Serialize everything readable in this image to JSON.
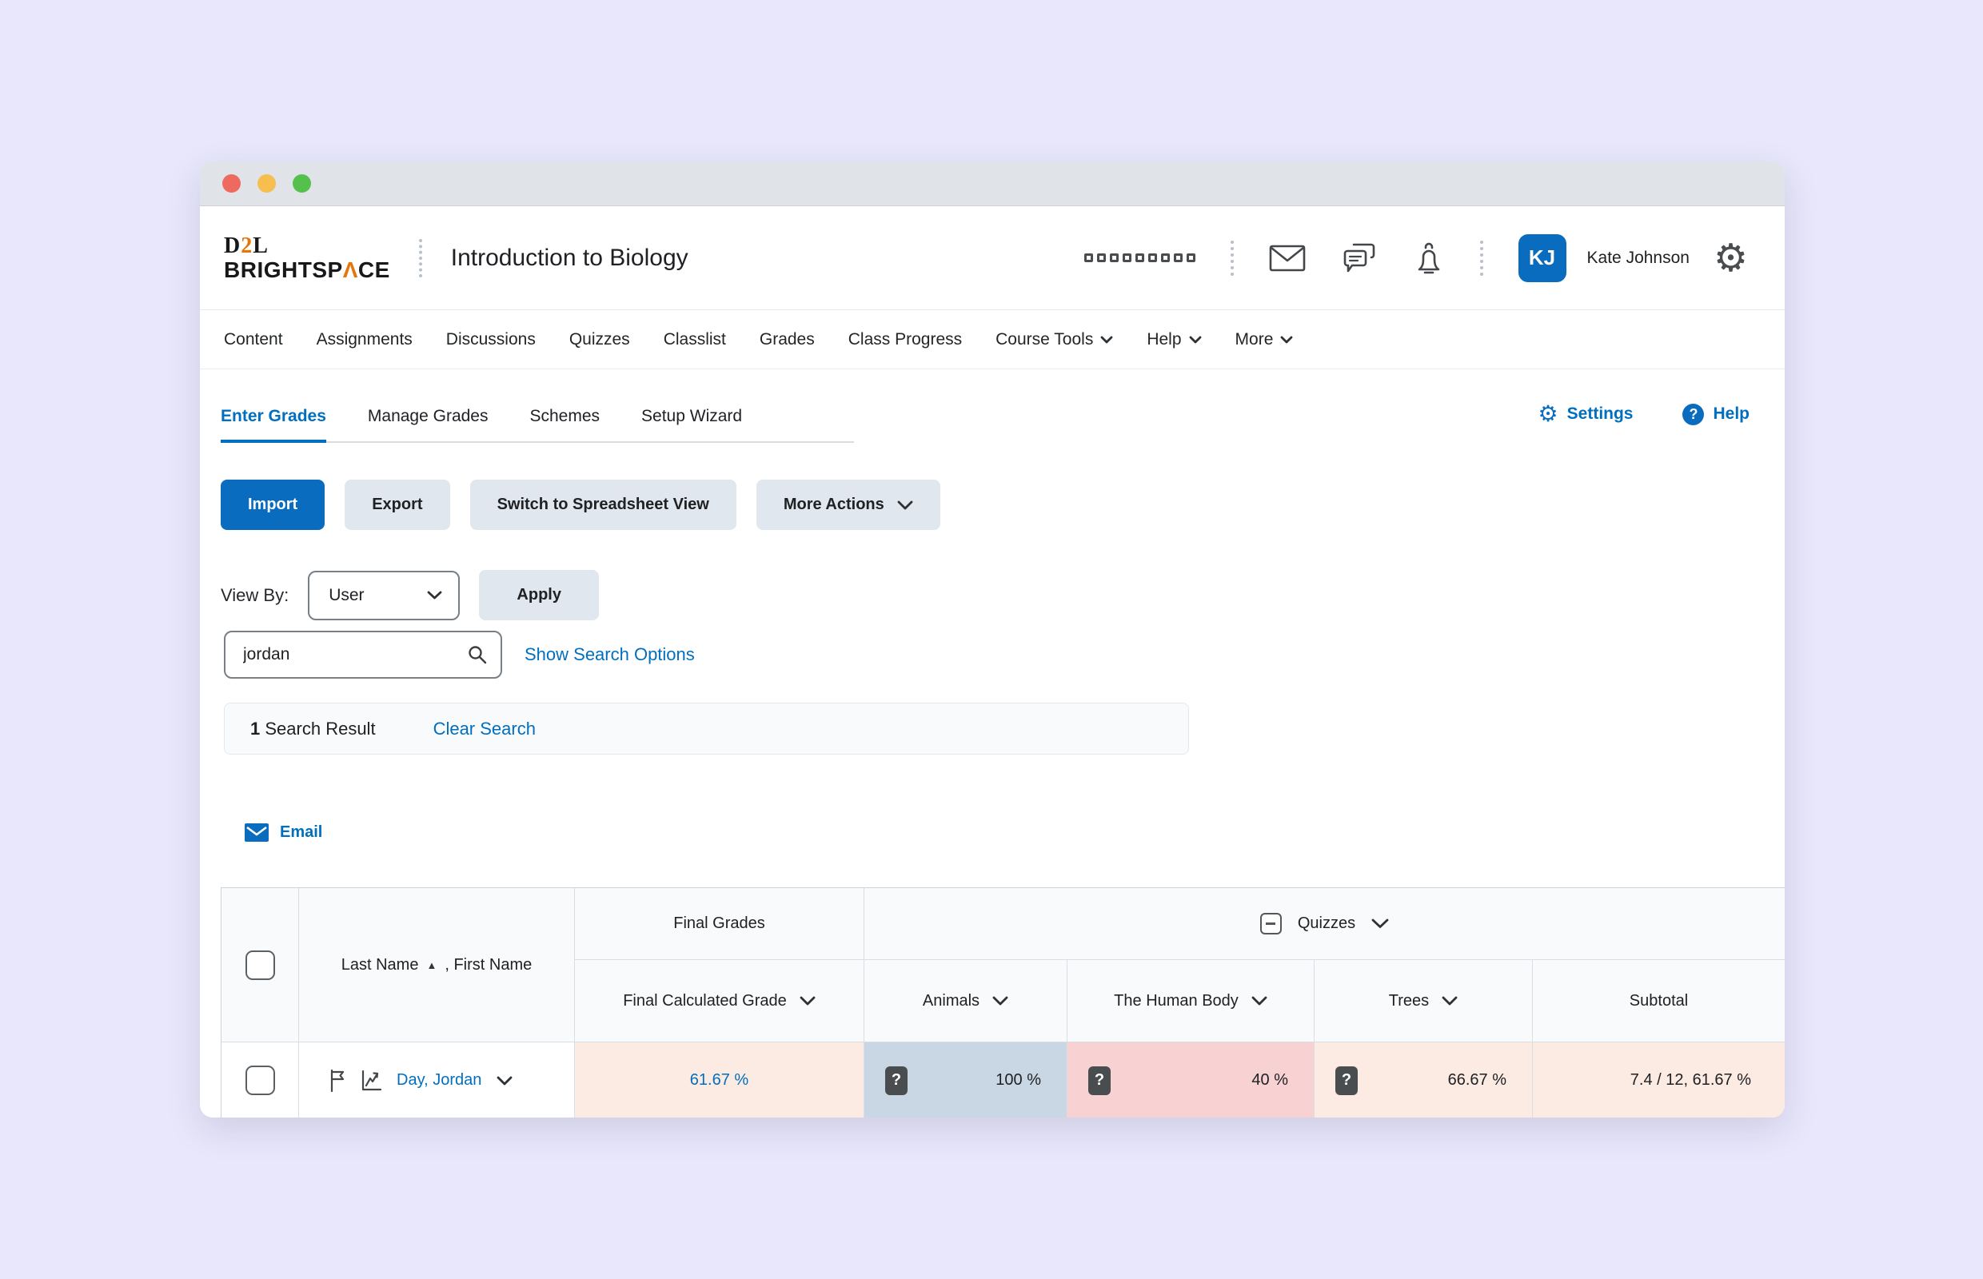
{
  "colors": {
    "brand_blue": "#006fbf",
    "button_blue": "#0a6cbe",
    "logo_accent_orange": "#e8740c",
    "cell_blue": "#c9d6e3",
    "cell_pink": "#f8d2d3",
    "cell_peach": "#fcebe2",
    "traffic_red": "#ee6a5f",
    "traffic_yellow": "#f5be4f",
    "traffic_green": "#56c04d"
  },
  "masthead": {
    "logo_d": "D",
    "logo_2": "2",
    "logo_l": "L",
    "logo_bs_pre": "BRIGHTSP",
    "logo_bs_caret": "Λ",
    "logo_bs_post": "CE",
    "course_title": "Introduction to Biology",
    "user_initials": "KJ",
    "user_name": "Kate Johnson"
  },
  "nav": {
    "items": [
      {
        "label": "Content"
      },
      {
        "label": "Assignments"
      },
      {
        "label": "Discussions"
      },
      {
        "label": "Quizzes"
      },
      {
        "label": "Classlist"
      },
      {
        "label": "Grades"
      },
      {
        "label": "Class Progress"
      },
      {
        "label": "Course Tools"
      },
      {
        "label": "Help"
      },
      {
        "label": "More"
      }
    ]
  },
  "tabs": {
    "items": [
      "Enter Grades",
      "Manage Grades",
      "Schemes",
      "Setup Wizard"
    ],
    "active": "Enter Grades",
    "settings": "Settings",
    "help": "Help"
  },
  "toolbar": {
    "import": "Import",
    "export": "Export",
    "spreadsheet_view": "Switch to Spreadsheet View",
    "more_actions": "More Actions"
  },
  "view_by": {
    "label": "View By:",
    "value": "User",
    "apply": "Apply"
  },
  "search": {
    "value": "jordan",
    "show_options": "Show Search Options",
    "result_count": "1",
    "result_label": "Search Result",
    "clear": "Clear Search"
  },
  "email_action": {
    "label": "Email"
  },
  "icons": {
    "question": "?",
    "sort_arrow": "▲",
    "gear": "⚙"
  },
  "grades_table": {
    "name_header": {
      "last": "Last Name",
      "rest": ", First Name"
    },
    "groups": {
      "final_grades": "Final Grades",
      "quizzes": "Quizzes"
    },
    "columns": {
      "final_calculated": "Final Calculated Grade",
      "animals": "Animals",
      "human_body": "The Human Body",
      "trees": "Trees",
      "subtotal": "Subtotal"
    },
    "row": {
      "name": "Day, Jordan",
      "final_grade": "61.67 %",
      "animals": "100 %",
      "human_body": "40 %",
      "trees": "66.67 %",
      "subtotal": "7.4 / 12, 61.67 %"
    }
  }
}
